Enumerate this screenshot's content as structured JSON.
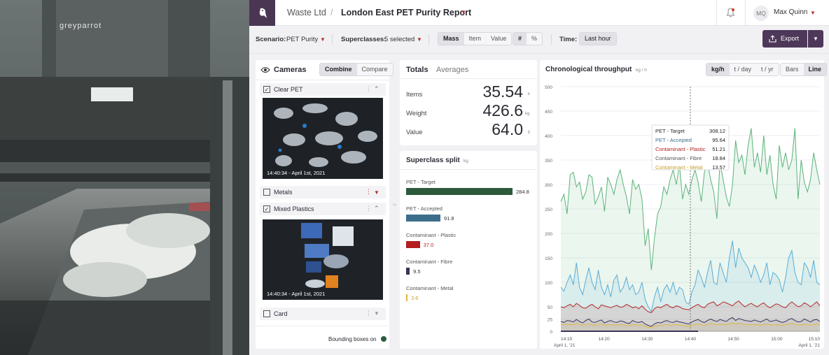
{
  "header": {
    "org": "Waste Ltd",
    "separator": "/",
    "report_title": "London East PET Purity Report",
    "user_initials": "MQ",
    "user_name": "Max Quinn",
    "photo_brand": "greyparrot"
  },
  "toolbar": {
    "scenario_label": "Scenario:",
    "scenario_value": "PET Purity",
    "superclasses_label": "Superclasses:",
    "superclasses_value": "5 selected",
    "units": [
      "Mass",
      "Item",
      "Value"
    ],
    "unit_selected": "Mass",
    "formats": [
      "#",
      "%"
    ],
    "format_selected": "#",
    "time_label": "Time:",
    "time_value": "Last hour",
    "export_label": "Export"
  },
  "cameras": {
    "title": "Cameras",
    "modes": [
      "Combine",
      "Compare"
    ],
    "mode_selected": "Combine",
    "items": [
      {
        "name": "Clear PET",
        "checked": true,
        "expanded": true,
        "timestamp": "14:40:34 - April 1st, 2021"
      },
      {
        "name": "Metals",
        "checked": false,
        "expanded": false
      },
      {
        "name": "Mixed Plastics",
        "checked": true,
        "expanded": true,
        "timestamp": "14:40:34 - April 1st, 2021"
      },
      {
        "name": "Card",
        "checked": false,
        "expanded": false
      }
    ],
    "bounding_label": "Bounding boxes on"
  },
  "totals": {
    "tabs": [
      "Totals",
      "Averages"
    ],
    "tab_selected": "Totals",
    "rows": [
      {
        "label": "Items",
        "value": "35.54",
        "unit": "k"
      },
      {
        "label": "Weight",
        "value": "426.6",
        "unit": "kg"
      },
      {
        "label": "Value",
        "value": "64.0",
        "unit": "£"
      }
    ]
  },
  "split": {
    "title": "Superclass split",
    "unit": "kg",
    "max": 284.8,
    "rows": [
      {
        "label": "PET - Target",
        "value": 284.8,
        "value_label": "284.8",
        "color": "#2d5a3d"
      },
      {
        "label": "PET - Accepted",
        "value": 91.8,
        "value_label": "91.8",
        "color": "#3c6e8c"
      },
      {
        "label": "Contaminant - Plastic",
        "value": 37.0,
        "value_label": "37.0",
        "color": "#b31d1d"
      },
      {
        "label": "Contaminant - Fibre",
        "value": 9.5,
        "value_label": "9.5",
        "color": "#3f3257"
      },
      {
        "label": "Contaminant - Metal",
        "value": 3.6,
        "value_label": "3.6",
        "color": "#e3b83a"
      }
    ]
  },
  "throughput": {
    "title": "Chronological throughput",
    "unit": "kg / h",
    "rates": [
      "kg/h",
      "t / day",
      "t / yr"
    ],
    "rate_selected": "kg/h",
    "styles": [
      "Bars",
      "Line"
    ],
    "style_selected": "Line"
  },
  "chart_data": {
    "type": "line",
    "title": "Chronological throughput",
    "ylabel": "kg / h",
    "ylim": [
      0,
      500
    ],
    "yticks": [
      0,
      25,
      50,
      100,
      150,
      200,
      250,
      300,
      350,
      400,
      450,
      500
    ],
    "xlim": [
      "14:10",
      "15:10"
    ],
    "xticks": [
      "14:10",
      "14:20",
      "14:30",
      "14:40",
      "14:50",
      "15:00",
      "15:10"
    ],
    "x_start_label": "April 1, '21",
    "x_end_label": "April 1, '21",
    "cursor_time": "14:40",
    "grid": true,
    "series": [
      {
        "name": "PET - Target",
        "color": "#5bb37a",
        "values": [
          265,
          280,
          240,
          320,
          325,
          295,
          305,
          270,
          285,
          320,
          315,
          260,
          275,
          295,
          245,
          315,
          300,
          280,
          310,
          330,
          300,
          275,
          240,
          310,
          290,
          300,
          270,
          175,
          210,
          125,
          190,
          240,
          255,
          295,
          280,
          310,
          330,
          300,
          340,
          270,
          300,
          280,
          310,
          330,
          305,
          265,
          325,
          345,
          310,
          285,
          230,
          345,
          310,
          275,
          255,
          300,
          390,
          345,
          360,
          320,
          380,
          415,
          335,
          365,
          325,
          400,
          320,
          360,
          300,
          270,
          380,
          335,
          365,
          330,
          350,
          415,
          270,
          350,
          305,
          285,
          310,
          365,
          330,
          300
        ]
      },
      {
        "name": "PET - Accepted",
        "color": "#5aaed6",
        "values": [
          90,
          82,
          100,
          115,
          95,
          140,
          90,
          75,
          105,
          130,
          100,
          85,
          125,
          90,
          75,
          95,
          70,
          105,
          115,
          80,
          90,
          110,
          85,
          95,
          75,
          80,
          100,
          65,
          50,
          40,
          70,
          90,
          60,
          85,
          95,
          80,
          100,
          75,
          90,
          85,
          60,
          55,
          80,
          95,
          125,
          110,
          90,
          120,
          145,
          100,
          95,
          140,
          120,
          100,
          150,
          185,
          130,
          170,
          150,
          140,
          130,
          110,
          135,
          120,
          100,
          115,
          140,
          95,
          120,
          115,
          105,
          80,
          110,
          150,
          165,
          120,
          100,
          95,
          140,
          130,
          110,
          145,
          100,
          95
        ]
      },
      {
        "name": "Contaminant - Plastic",
        "color": "#b5292c",
        "values": [
          50,
          48,
          52,
          55,
          50,
          57,
          53,
          48,
          47,
          52,
          55,
          50,
          46,
          54,
          52,
          50,
          48,
          51,
          53,
          49,
          50,
          55,
          52,
          48,
          50,
          46,
          52,
          45,
          40,
          38,
          46,
          50,
          48,
          52,
          55,
          50,
          48,
          52,
          50,
          46,
          45,
          44,
          48,
          52,
          55,
          50,
          48,
          55,
          58,
          60,
          52,
          55,
          60,
          58,
          55,
          52,
          58,
          62,
          55,
          50,
          54,
          57,
          53,
          50,
          55,
          58,
          52,
          48,
          52,
          56,
          54,
          50,
          48,
          55,
          60,
          55,
          50,
          52,
          58,
          55,
          50,
          55,
          60,
          52
        ]
      },
      {
        "name": "Contaminant - Fibre",
        "color": "#3f3257",
        "values": [
          20,
          18,
          22,
          21,
          19,
          24,
          20,
          17,
          22,
          25,
          19,
          18,
          21,
          23,
          17,
          20,
          22,
          19,
          18,
          21,
          20,
          17,
          16,
          22,
          19,
          18,
          20,
          15,
          12,
          10,
          15,
          18,
          17,
          20,
          22,
          19,
          18,
          21,
          19,
          18,
          16,
          15,
          19,
          22,
          24,
          20,
          18,
          22,
          25,
          22,
          20,
          24,
          22,
          20,
          25,
          28,
          22,
          26,
          24,
          22,
          21,
          20,
          23,
          21,
          19,
          22,
          25,
          20,
          21,
          23,
          20,
          18,
          20,
          24,
          26,
          22,
          19,
          20,
          25,
          22,
          19,
          23,
          24,
          20
        ]
      },
      {
        "name": "Contaminant - Metal",
        "color": "#e3b83a",
        "values": [
          14,
          13,
          15,
          14,
          13,
          16,
          14,
          12,
          14,
          15,
          13,
          12,
          14,
          15,
          12,
          13,
          14,
          12,
          13,
          14,
          13,
          12,
          11,
          14,
          13,
          12,
          13,
          10,
          8,
          7,
          10,
          12,
          11,
          13,
          14,
          12,
          13,
          14,
          13,
          12,
          11,
          10,
          12,
          14,
          15,
          13,
          12,
          14,
          16,
          14,
          13,
          15,
          14,
          13,
          15,
          17,
          14,
          16,
          15,
          14,
          13,
          13,
          14,
          13,
          12,
          14,
          15,
          13,
          13,
          14,
          13,
          12,
          13,
          15,
          16,
          14,
          12,
          13,
          15,
          14,
          12,
          14,
          15,
          13
        ]
      }
    ],
    "tooltip": [
      {
        "name": "PET - Target",
        "value": "308.12",
        "color": "#2a2a33"
      },
      {
        "name": "PET - Accepted",
        "value": "95.64",
        "color": "#3c6e8c"
      },
      {
        "name": "Contaminant - Plastic",
        "value": "51.21",
        "color": "#b31d1d"
      },
      {
        "name": "Contaminant - Fibre",
        "value": "18.84",
        "color": "#555"
      },
      {
        "name": "Contaminant - Metal",
        "value": "13.57",
        "color": "#c9a020"
      }
    ]
  }
}
